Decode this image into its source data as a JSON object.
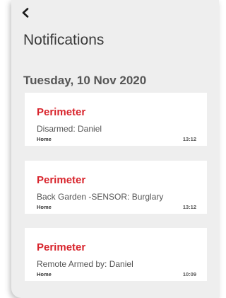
{
  "header": {
    "back_icon": "chevron-left-icon",
    "title": "Notifications"
  },
  "section": {
    "date": "Tuesday, 10 Nov 2020"
  },
  "notifications": [
    {
      "title": "Perimeter",
      "message": "Disarmed: Daniel",
      "location": "Home",
      "time": "13:12"
    },
    {
      "title": "Perimeter",
      "message": "Back Garden -SENSOR: Burglary",
      "location": "Home",
      "time": "13:12"
    },
    {
      "title": "Perimeter",
      "message": "Remote Armed by: Daniel",
      "location": "Home",
      "time": "10:09"
    }
  ],
  "colors": {
    "background": "#eeeeee",
    "card": "#ffffff",
    "accent_red": "#d8242c",
    "title_text": "#3a3a3a"
  }
}
